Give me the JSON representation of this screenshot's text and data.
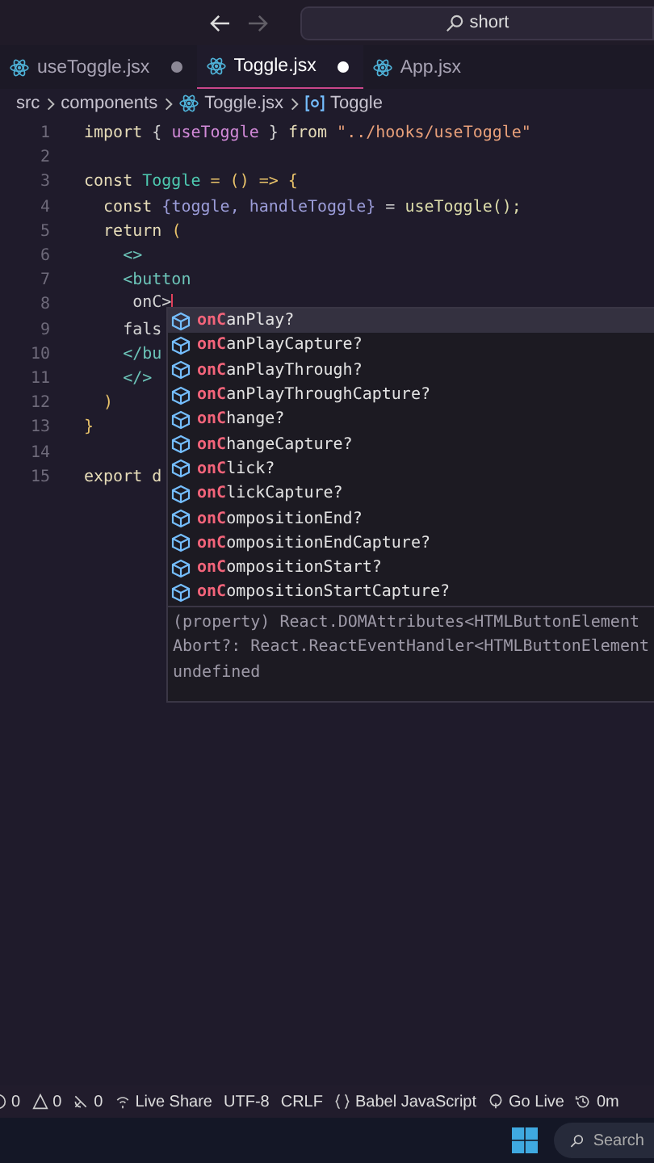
{
  "title_bar": {
    "search": {
      "value": "short"
    },
    "back_disabled": false,
    "forward_disabled": true
  },
  "tabs": [
    {
      "label": "useToggle.jsx",
      "selected": false,
      "modified": true
    },
    {
      "label": "Toggle.jsx",
      "selected": true,
      "modified": true
    },
    {
      "label": "App.jsx",
      "selected": false,
      "modified": false
    }
  ],
  "breadcrumb": [
    "src",
    "components",
    "Toggle.jsx",
    "Toggle"
  ],
  "editor": {
    "lines": [
      {
        "number": "1",
        "tokens": [
          {
            "text": "import",
            "kind": "kw"
          },
          {
            "text": "{",
            "kind": "plain"
          },
          {
            "text": "useToggle",
            "kind": "var"
          },
          {
            "text": "}",
            "kind": "plain"
          },
          {
            "text": "from",
            "kind": "kw"
          },
          {
            "text": "\"../hooks/useToggle\"",
            "kind": "str"
          }
        ]
      },
      {
        "number": "2"
      },
      {
        "number": "3",
        "tokens": [
          {
            "text": "const",
            "kind": "kw"
          },
          {
            "text": "Toggle",
            "kind": "type"
          },
          {
            "text": "= () => {",
            "kind": "brace"
          }
        ]
      },
      {
        "number": "4",
        "tokens": [
          {
            "text": "  const",
            "kind": "kw"
          },
          {
            "text": "{toggle, handleToggle}",
            "kind": "ident"
          },
          {
            "text": "=",
            "kind": "plain"
          },
          {
            "text": "useToggle();",
            "kind": "fn"
          }
        ]
      },
      {
        "number": "5",
        "tokens": [
          {
            "text": "  return",
            "kind": "kw"
          },
          {
            "text": "(",
            "kind": "brace"
          }
        ]
      },
      {
        "number": "6",
        "tokens": [
          {
            "text": "    <>",
            "kind": "tag"
          }
        ]
      },
      {
        "number": "7",
        "tokens": [
          {
            "text": "    <button",
            "kind": "tag"
          }
        ]
      },
      {
        "number": "8",
        "cursor": true,
        "tokens": [
          {
            "text": "     onC>",
            "kind": "plain"
          }
        ]
      },
      {
        "number": "9",
        "tokens": [
          {
            "text": "    fals",
            "kind": "plain"
          }
        ]
      },
      {
        "number": "10",
        "tokens": [
          {
            "text": "    </bu",
            "kind": "tag"
          }
        ]
      },
      {
        "number": "11",
        "tokens": [
          {
            "text": "    </>",
            "kind": "tag"
          }
        ]
      },
      {
        "number": "12",
        "tokens": [
          {
            "text": "  )",
            "kind": "brace"
          }
        ]
      },
      {
        "number": "13",
        "tokens": [
          {
            "text": "}",
            "kind": "brace"
          }
        ]
      },
      {
        "number": "14"
      },
      {
        "number": "15",
        "tokens": [
          {
            "text": "export d",
            "kind": "kw"
          }
        ]
      }
    ]
  },
  "suggestions": [
    {
      "label": "**onC**anPlay?",
      "selected": true
    },
    {
      "label": "**onC**anPlayCapture?",
      "selected": false
    },
    {
      "label": "**onC**anPlayThrough?",
      "selected": false
    },
    {
      "label": "**onC**anPlayThroughCapture?",
      "selected": false
    },
    {
      "label": "**onC**hange?",
      "selected": false
    },
    {
      "label": "**onC**hangeCapture?",
      "selected": false
    },
    {
      "label": "**onC**lick?",
      "selected": false
    },
    {
      "label": "**onC**lickCapture?",
      "selected": false
    },
    {
      "label": "**onC**ompositionEnd?",
      "selected": false
    },
    {
      "label": "**onC**ompositionEndCapture?",
      "selected": false
    },
    {
      "label": "**onC**ompositionStart?",
      "selected": false
    },
    {
      "label": "**onC**ompositionStartCapture?",
      "selected": false
    }
  ],
  "details": [
    "(property) React.DOMAttributes<HTMLButtonElement",
    "Abort?: React.ReactEventHandler<HTMLButtonElement",
    "undefined"
  ],
  "status_bar": [
    {
      "kind": "errors",
      "text": "0"
    },
    {
      "kind": "warnings",
      "text": "0"
    },
    {
      "kind": "ports",
      "text": "0"
    },
    {
      "kind": "share",
      "text": "Live Share"
    },
    {
      "kind": "plain",
      "text": "UTF-8"
    },
    {
      "kind": "plain",
      "text": "CRLF"
    },
    {
      "kind": "language",
      "text": "Babel JavaScript"
    },
    {
      "kind": "live",
      "text": "Go Live"
    },
    {
      "kind": "time",
      "text": "0m"
    }
  ],
  "taskbar": {
    "search": {
      "placeholder": "Search"
    }
  }
}
